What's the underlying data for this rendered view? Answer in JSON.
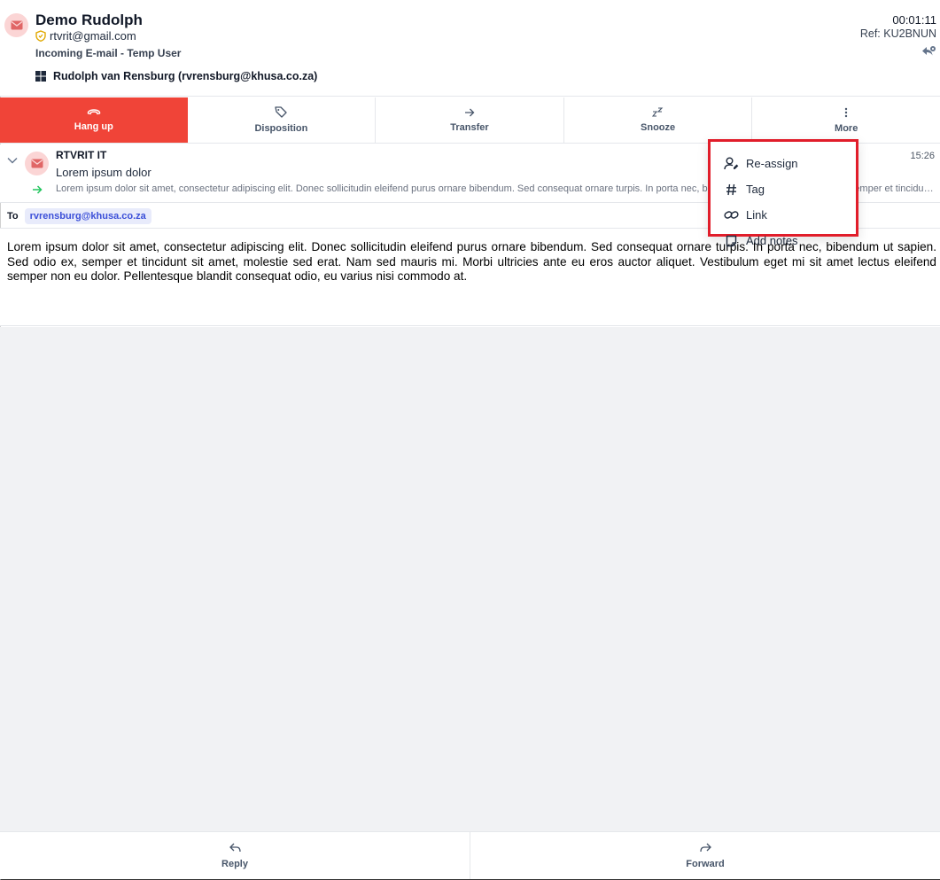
{
  "header": {
    "name": "Demo Rudolph",
    "email": "rtvrit@gmail.com",
    "subline": "Incoming E-mail - Temp User",
    "agent": "Rudolph van Rensburg (rvrensburg@khusa.co.za)",
    "timer": "00:01:11",
    "ref": "Ref: KU2BNUN"
  },
  "toolbar": {
    "hangup": "Hang up",
    "disposition": "Disposition",
    "transfer": "Transfer",
    "snooze": "Snooze",
    "more": "More"
  },
  "message": {
    "sender": "RTVRIT IT",
    "subject": "Lorem ipsum dolor",
    "preview": "Lorem ipsum dolor sit amet, consectetur adipiscing elit. Donec sollicitudin eleifend purus ornare bibendum. Sed consequat ornare turpis. In porta nec, bibendum ut sapien. Sed odio ex, semper et tincidunt sit amet, molestie sed erat. Nam sed mauris mi. Morbi ultricies ante eu eros auctor aliquet. Vestibulum eget mi sit amet lectus eleifend semper non eu dolor. Pellentesque blandit consequat odio, eu varius nisi commodo at. bibendum ut s...",
    "time": "15:26",
    "to_label": "To",
    "to_address": "rvrensburg@khusa.co.za",
    "body": "Lorem ipsum dolor sit amet, consectetur adipiscing elit. Donec sollicitudin eleifend purus ornare bibendum. Sed consequat ornare turpis. In porta nec, bibendum ut sapien. Sed odio ex, semper et tincidunt sit amet, molestie sed erat. Nam sed mauris mi. Morbi ultricies ante eu eros auctor aliquet. Vestibulum eget mi sit amet lectus eleifend semper non eu dolor. Pellentesque blandit consequat odio, eu varius nisi commodo at."
  },
  "menu": {
    "items": [
      {
        "label": "Re-assign",
        "icon": "user-edit-icon"
      },
      {
        "label": "Tag",
        "icon": "hash-icon"
      },
      {
        "label": "Link",
        "icon": "link-icon"
      },
      {
        "label": "Add notes",
        "icon": "note-icon"
      }
    ]
  },
  "footer": {
    "reply": "Reply",
    "forward": "Forward"
  },
  "colors": {
    "hangup": "#f04438",
    "menu_highlight": "#e11d2a",
    "chip_text": "#3b4fd8",
    "chip_bg": "#e8ebfb"
  }
}
